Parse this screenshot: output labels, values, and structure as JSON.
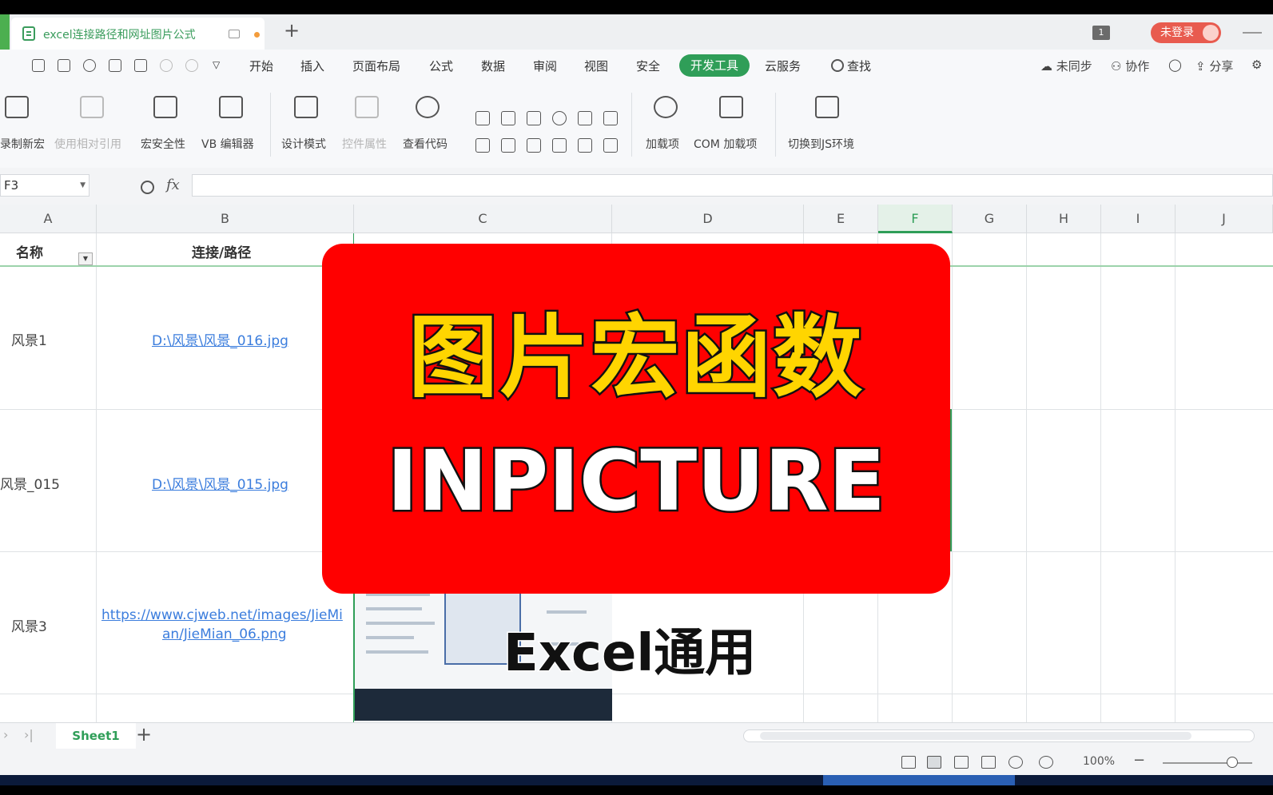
{
  "window": {
    "tab_title": "excel连接路径和网址图片公式",
    "new_tab": "+",
    "badge_count": "1",
    "login": "未登录"
  },
  "menu": {
    "items": [
      "开始",
      "插入",
      "页面布局",
      "公式",
      "数据",
      "审阅",
      "视图",
      "安全",
      "开发工具",
      "云服务",
      "查找"
    ],
    "active": "开发工具",
    "right": [
      "未同步",
      "协作",
      "分享"
    ]
  },
  "ribbon": {
    "groups": [
      {
        "label": "录制新宏",
        "enabled": true
      },
      {
        "label": "使用相对引用",
        "enabled": false
      },
      {
        "label": "宏安全性",
        "enabled": true
      },
      {
        "label": "VB 编辑器",
        "enabled": true
      },
      {
        "label": "设计模式",
        "enabled": true
      },
      {
        "label": "控件属性",
        "enabled": false
      },
      {
        "label": "查看代码",
        "enabled": true
      },
      {
        "label": "加载项",
        "enabled": true
      },
      {
        "label": "COM 加载项",
        "enabled": true
      },
      {
        "label": "切换到JS环境",
        "enabled": true
      }
    ]
  },
  "formula_bar": {
    "name_box": "F3",
    "fx": "fx",
    "value": ""
  },
  "columns": [
    "A",
    "B",
    "C",
    "D",
    "E",
    "F",
    "G",
    "H",
    "I",
    "J"
  ],
  "selected_column": "F",
  "table": {
    "headers": [
      "名称",
      "连接/路径"
    ],
    "rows": [
      {
        "name": "风景1",
        "path": "D:\\风景\\风景_016.jpg"
      },
      {
        "name": "风景_015",
        "path": "D:\\风景\\风景_015.jpg"
      },
      {
        "name": "风景3",
        "path_line1": "https://www.cjweb.net/images/JieMi",
        "path_line2": "an/JieMian_06.png"
      }
    ]
  },
  "overlay": {
    "title_cn": "图片宏函数",
    "title_en": "INPICTURE",
    "subtitle": "Excel通用"
  },
  "sheets": {
    "tabs": [
      "Sheet1"
    ],
    "add": "+"
  },
  "status": {
    "zoom": "100%"
  },
  "colors": {
    "accent": "#2f9e58",
    "overlay_bg": "#ff0000",
    "title_cn": "#ffd500",
    "link": "#3b7ddd"
  }
}
